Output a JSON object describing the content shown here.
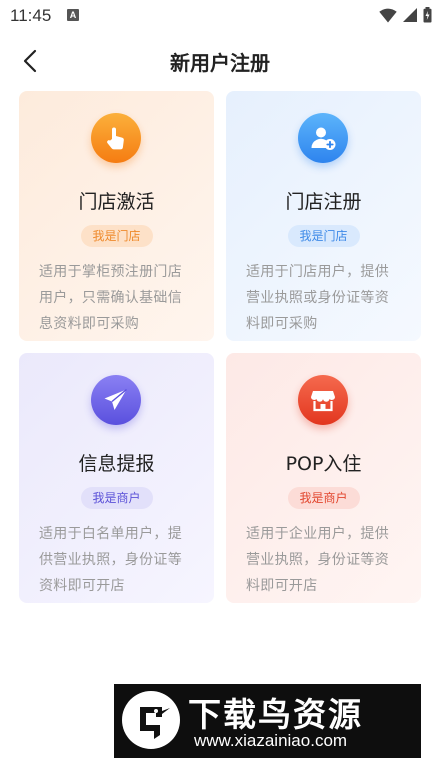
{
  "status_bar": {
    "time": "11:45",
    "notification_letter": "A"
  },
  "header": {
    "title": "新用户注册"
  },
  "cards": [
    {
      "title": "门店激活",
      "badge": "我是门店",
      "description": "适用于掌柜预注册门店用户，只需确认基础信息资料即可采购",
      "icon": "hand-pointer-icon",
      "accent": "#f57c12"
    },
    {
      "title": "门店注册",
      "badge": "我是门店",
      "description": "适用于门店用户，提供营业执照或身份证等资料即可采购",
      "icon": "user-add-icon",
      "accent": "#2e84ee"
    },
    {
      "title": "信息提报",
      "badge": "我是商户",
      "description": "适用于白名单用户，提供营业执照，身份证等资料即可开店",
      "icon": "paper-plane-icon",
      "accent": "#5a50de"
    },
    {
      "title": "POP入住",
      "badge": "我是商户",
      "description": "适用于企业用户，提供营业执照，身份证等资料即可开店",
      "icon": "storefront-icon",
      "accent": "#e2361f"
    }
  ],
  "watermark": {
    "text": "下载鸟资源",
    "url": "www.xiazainiao.com"
  }
}
